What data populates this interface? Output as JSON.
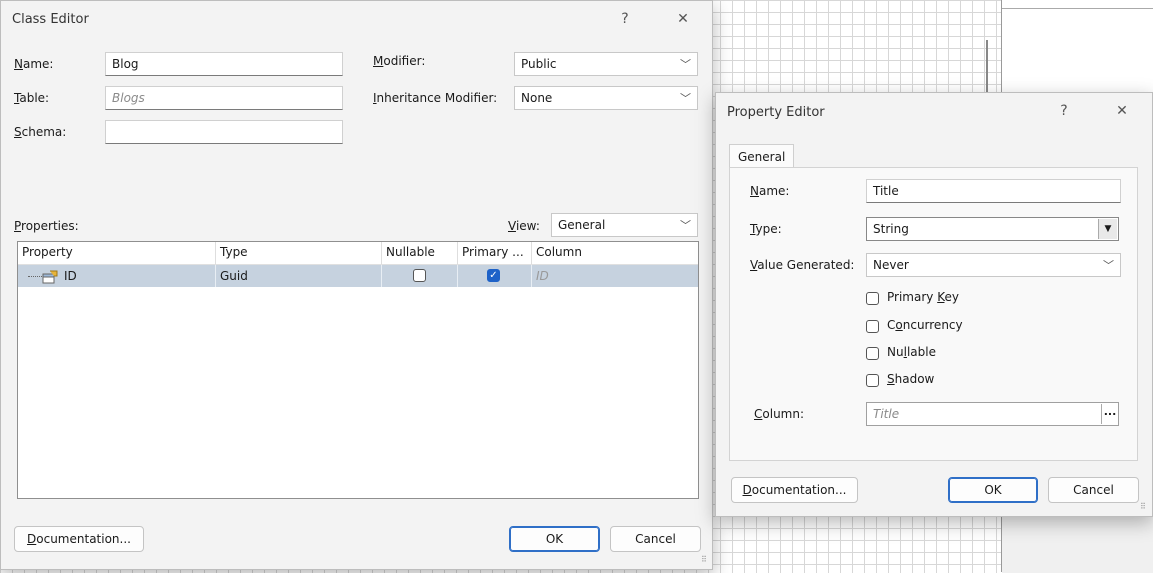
{
  "class_editor": {
    "title": "Class Editor",
    "help": "?",
    "close": "✕",
    "name_label_u": "N",
    "name_label_rest": "ame:",
    "name_value": "Blog",
    "table_label_u": "T",
    "table_label_rest": "able:",
    "table_placeholder": "Blogs",
    "schema_label_u": "S",
    "schema_label_rest": "chema:",
    "schema_value": "",
    "modifier_label_u": "M",
    "modifier_label_rest": "odifier:",
    "modifier_value": "Public",
    "inherit_label_u": "I",
    "inherit_label_rest": "nheritance Modifier:",
    "inherit_value": "None",
    "properties_label_u": "P",
    "properties_label_rest": "roperties:",
    "view_label_u": "V",
    "view_label_rest": "iew:",
    "view_value": "General",
    "columns": [
      "Property",
      "Type",
      "Nullable",
      "Primary ...",
      "Column"
    ],
    "rows": [
      {
        "property": "ID",
        "type": "Guid",
        "nullable": false,
        "primary": true,
        "column": "ID"
      }
    ],
    "doc_button_u": "D",
    "doc_button_rest": "ocumentation...",
    "ok": "OK",
    "cancel": "Cancel"
  },
  "property_editor": {
    "title": "Property Editor",
    "help": "?",
    "close": "✕",
    "tab": "General",
    "name_label_u": "N",
    "name_label_rest": "ame:",
    "name_value": "Title",
    "type_label_u": "T",
    "type_label_rest": "ype:",
    "type_value": "String",
    "valgen_label_u": "V",
    "valgen_label_rest": "alue Generated:",
    "valgen_value": "Never",
    "primary_key_pre": "Primary ",
    "primary_key_u": "K",
    "primary_key_rest": "ey",
    "concurrency_pre": "C",
    "concurrency_u": "o",
    "concurrency_rest": "ncurrency",
    "nullable_pre": "Nu",
    "nullable_u": "l",
    "nullable_rest": "lable",
    "shadow_pre": "",
    "shadow_u": "S",
    "shadow_rest": "hadow",
    "column_label_u": "C",
    "column_label_rest": "olumn:",
    "column_placeholder": "Title",
    "ellipsis": "...",
    "doc_button_u": "D",
    "doc_button_rest": "ocumentation...",
    "ok": "OK",
    "cancel": "Cancel"
  }
}
